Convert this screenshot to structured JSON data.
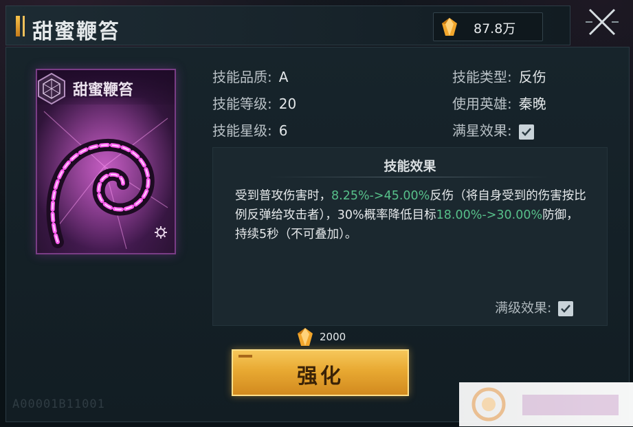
{
  "header": {
    "title": "甜蜜鞭笞",
    "currency_amount": "87.8万"
  },
  "card": {
    "name": "甜蜜鞭笞"
  },
  "info": {
    "quality_label": "技能品质:",
    "quality_value": "A",
    "level_label": "技能等级:",
    "level_value": "20",
    "star_label": "技能星级:",
    "star_value": "6",
    "type_label": "技能类型:",
    "type_value": "反伤",
    "hero_label": "使用英雄:",
    "hero_value": "秦晚",
    "full_star_label": "满星效果:",
    "full_star_checked": true
  },
  "effect": {
    "title": "技能效果",
    "seg1": "受到普攻伤害时，",
    "seg2": "8.25%->45.00%",
    "seg3": "反伤（将自身受到的伤害按比例反弹给攻击者），30%概率降低目标",
    "seg4": "18.00%->30.00%",
    "seg5": "防御，持续5秒（不可叠加）。",
    "max_level_label": "满级效果:",
    "max_level_checked": true
  },
  "enhance": {
    "cost": "2000",
    "label": "强化"
  },
  "footer": {
    "id_text": "A00001B11001"
  },
  "colors": {
    "highlight": "#57c08a",
    "button_gold": "#e8a932",
    "card_purple": "#6d2a7a"
  }
}
